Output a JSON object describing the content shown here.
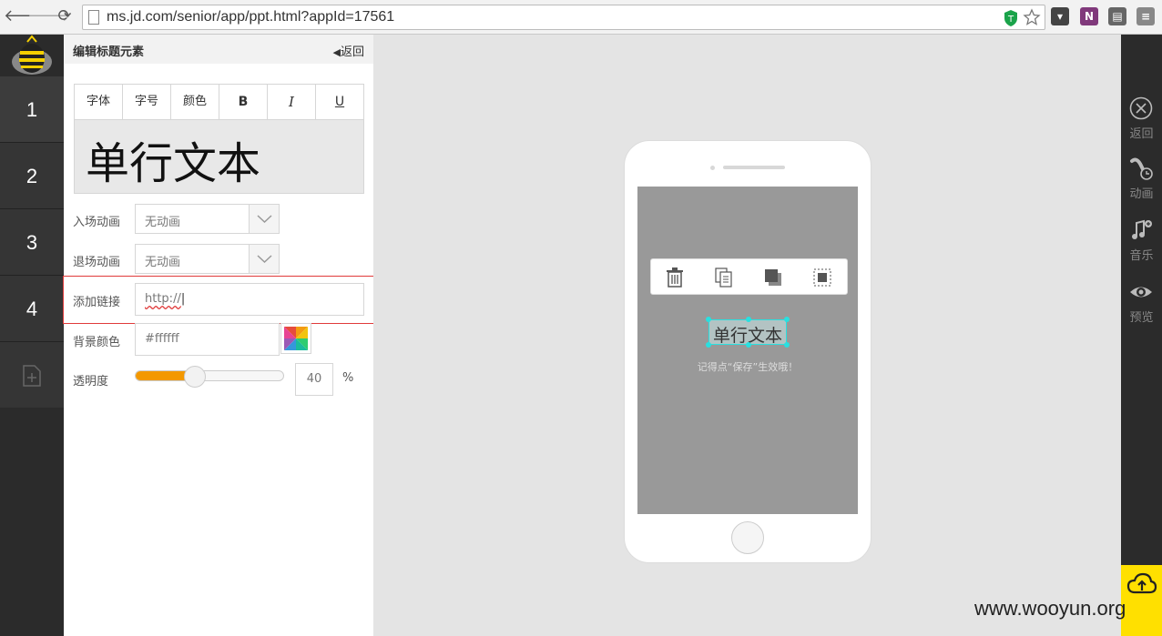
{
  "browser": {
    "url": "ms.jd.com/senior/app/ppt.html?appId=17561",
    "back_glyph": "🡐",
    "forward_glyph": "🡒",
    "reload_glyph": "⟳"
  },
  "slides": {
    "items": [
      "1",
      "2",
      "3",
      "4"
    ]
  },
  "panel": {
    "title": "编辑标题元素",
    "back_label": "返回",
    "toolbar": {
      "font": "字体",
      "size": "字号",
      "color": "颜色",
      "bold": "B",
      "italic": "I",
      "underline": "U"
    },
    "preview_text": "单行文本",
    "enter_anim_label": "入场动画",
    "enter_anim_value": "无动画",
    "exit_anim_label": "退场动画",
    "exit_anim_value": "无动画",
    "link_label": "添加链接",
    "link_value": "http://",
    "bg_color_label": "背景颜色",
    "bg_color_value": "#ffffff",
    "opacity_label": "透明度",
    "opacity_value": "40",
    "opacity_unit": "%",
    "opacity_fraction": 0.4
  },
  "canvas": {
    "selected_text": "单行文本",
    "hint": "记得点“保存”生效哦！"
  },
  "right_bar": {
    "back": "返回",
    "anim": "动画",
    "music": "音乐",
    "preview": "预览"
  },
  "watermark": "www.wooyun.org",
  "colors": {
    "accent": "#f39800",
    "selection": "#29e0e0",
    "highlight_border": "#e03a3a",
    "save_yellow": "#ffe000"
  }
}
